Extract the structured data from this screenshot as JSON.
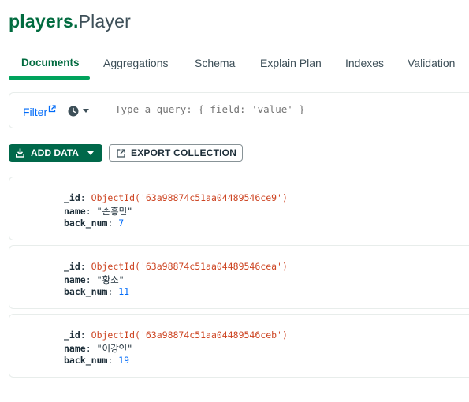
{
  "header": {
    "database": "players",
    "separator": ".",
    "collection": "Player"
  },
  "tabs": [
    {
      "label": "Documents",
      "active": true
    },
    {
      "label": "Aggregations"
    },
    {
      "label": "Schema"
    },
    {
      "label": "Explain Plan"
    },
    {
      "label": "Indexes"
    },
    {
      "label": "Validation"
    }
  ],
  "query": {
    "filter_label": "Filter",
    "placeholder": "Type a query: { field: 'value' }"
  },
  "toolbar": {
    "add_data_label": "ADD DATA",
    "export_label": "EXPORT COLLECTION"
  },
  "documents": [
    {
      "id_key": "_id",
      "id_value": "ObjectId('63a98874c51aa04489546ce9')",
      "name_key": "name",
      "name_value": "\"손흥민\"",
      "back_key": "back_num",
      "back_value": "7"
    },
    {
      "id_key": "_id",
      "id_value": "ObjectId('63a98874c51aa04489546cea')",
      "name_key": "name",
      "name_value": "\"황소\"",
      "back_key": "back_num",
      "back_value": "11"
    },
    {
      "id_key": "_id",
      "id_value": "ObjectId('63a98874c51aa04489546ceb')",
      "name_key": "name",
      "name_value": "\"이강인\"",
      "back_key": "back_num",
      "back_value": "19"
    }
  ],
  "colors": {
    "brand_green": "#016b3f",
    "tab_underline": "#00a35c",
    "button_green": "#00684a",
    "link_blue": "#016bf8",
    "objectid_red": "#cd4523"
  },
  "icons": {
    "filter_link": "external-link-icon",
    "history": "clock-icon",
    "add_data": "download-icon",
    "export": "export-icon"
  }
}
